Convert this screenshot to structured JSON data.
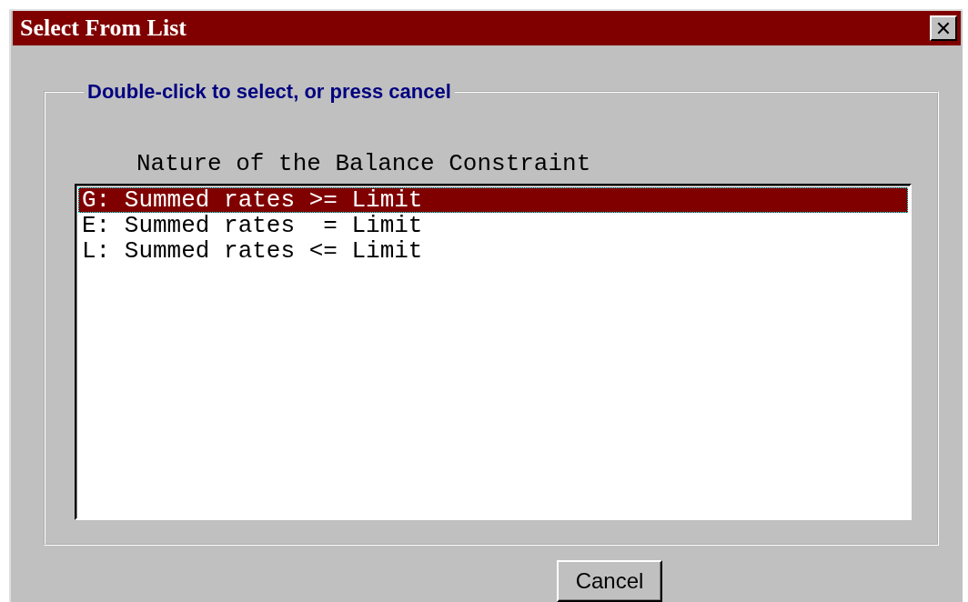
{
  "window": {
    "title": "Select From List",
    "close": "✕"
  },
  "group": {
    "label": "Double-click to select, or press cancel"
  },
  "list": {
    "header": "Nature of the Balance Constraint",
    "items": [
      {
        "label": "G: Summed rates >= Limit",
        "selected": true
      },
      {
        "label": "E: Summed rates  = Limit",
        "selected": false
      },
      {
        "label": "L: Summed rates <= Limit",
        "selected": false
      }
    ]
  },
  "buttons": [
    {
      "label": "Cancel"
    }
  ]
}
